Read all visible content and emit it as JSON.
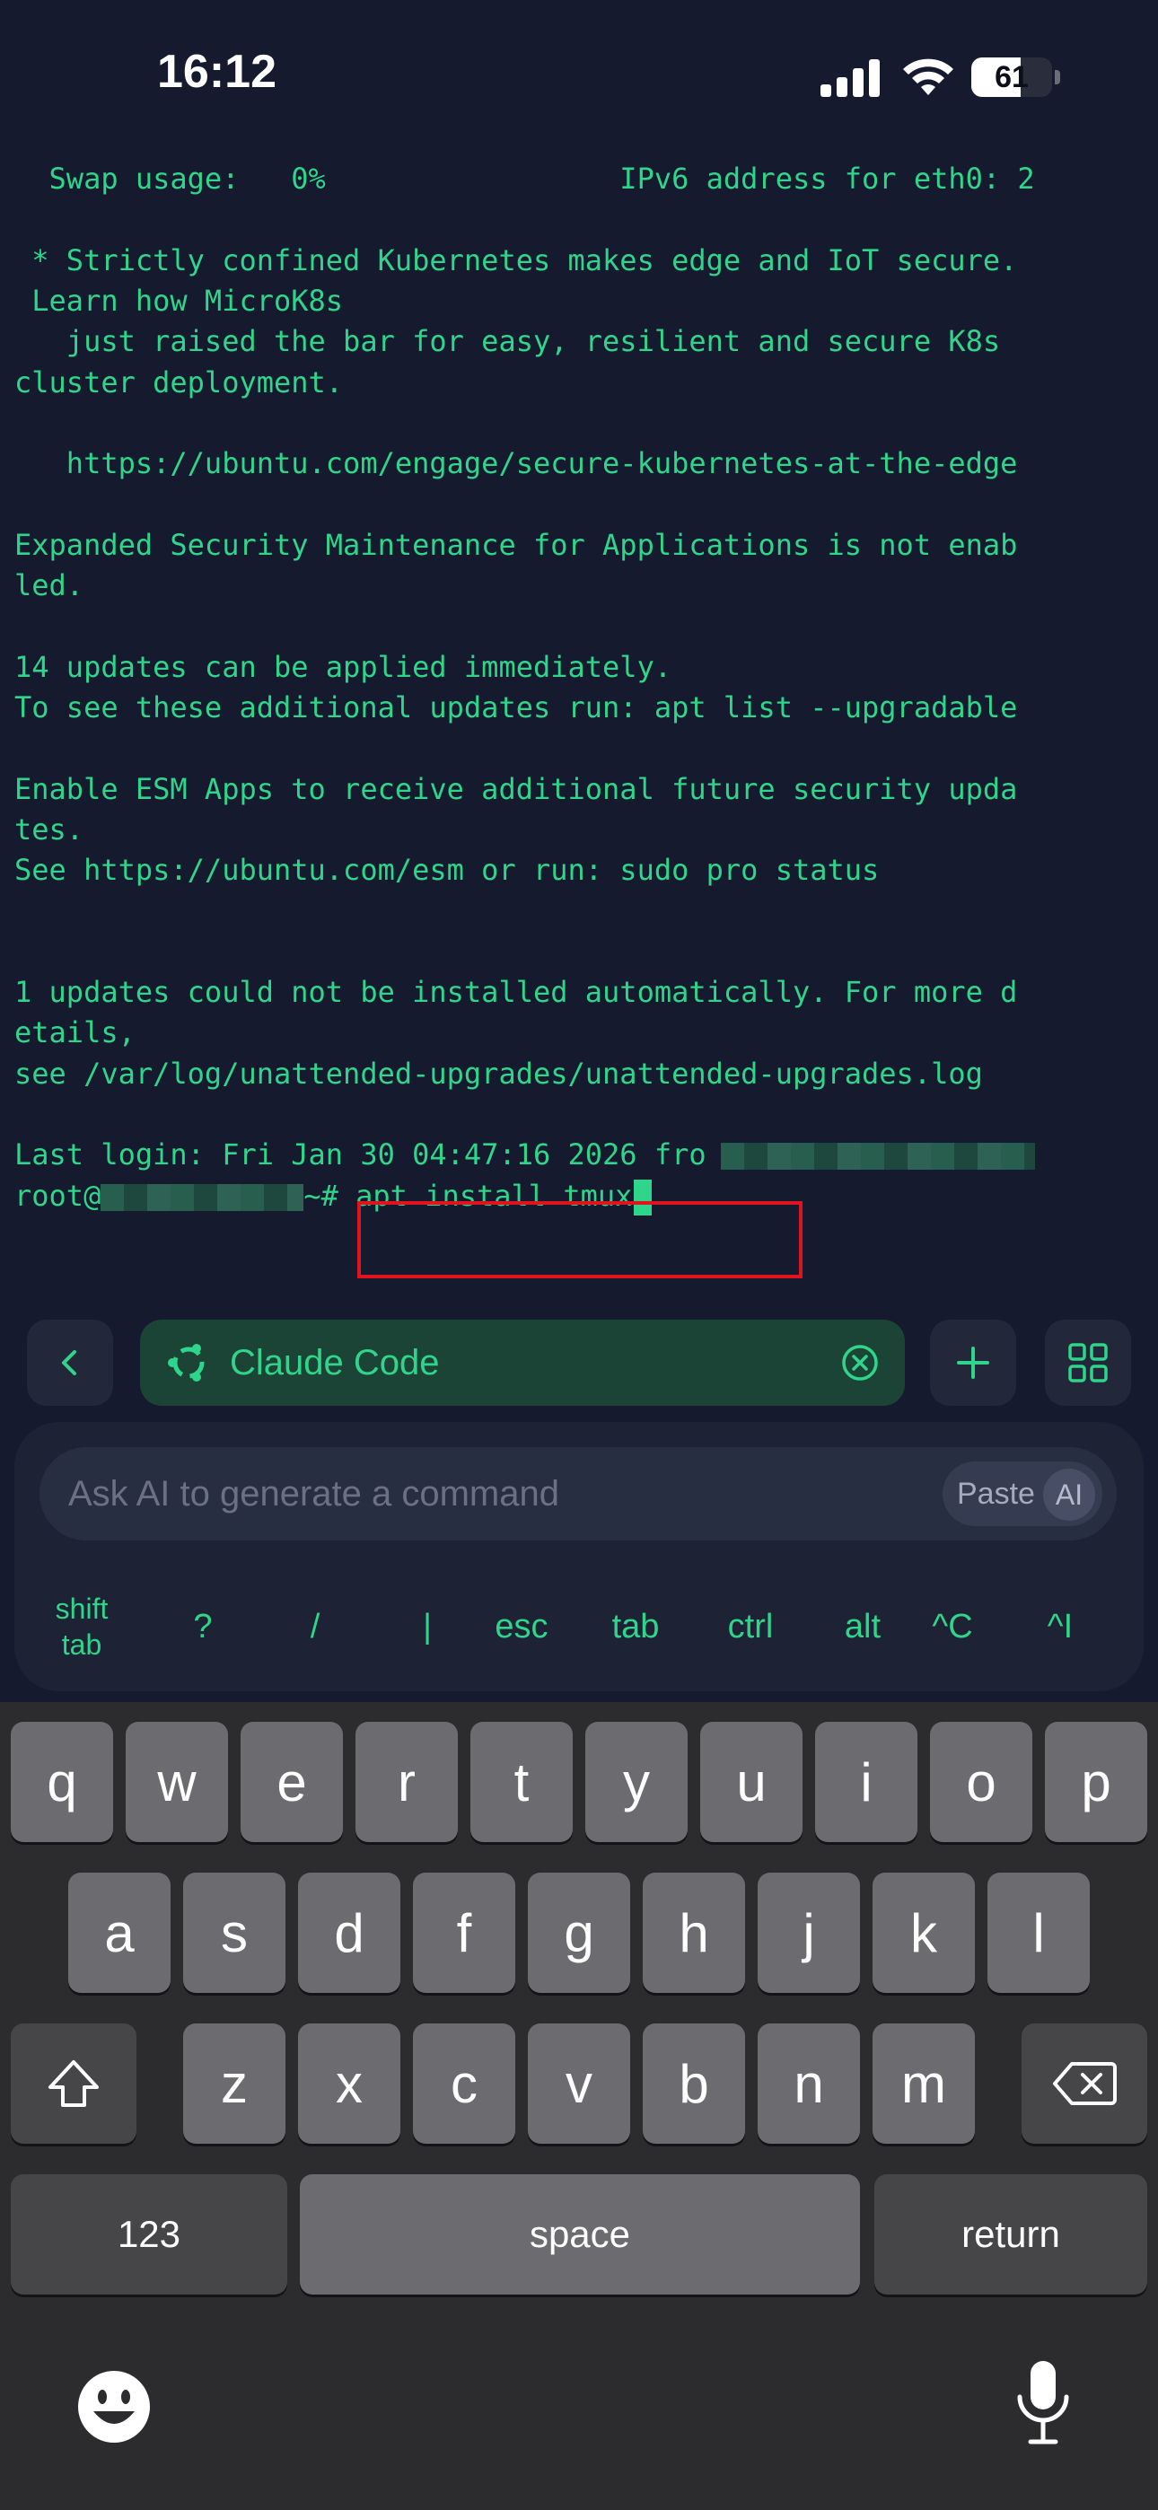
{
  "status_bar": {
    "time": "16:12",
    "battery": "61",
    "battery_level": 0.61
  },
  "terminal": {
    "lines": [
      "  Swap usage:   0%                 IPv6 address for eth0: 2",
      "",
      " * Strictly confined Kubernetes makes edge and IoT secure.",
      " Learn how MicroK8s",
      "   just raised the bar for easy, resilient and secure K8s",
      "cluster deployment.",
      "",
      "   https://ubuntu.com/engage/secure-kubernetes-at-the-edge",
      "",
      "Expanded Security Maintenance for Applications is not enab",
      "led.",
      "",
      "14 updates can be applied immediately.",
      "To see these additional updates run: apt list --upgradable",
      "",
      "Enable ESM Apps to receive additional future security upda",
      "tes.",
      "See https://ubuntu.com/esm or run: sudo pro status",
      "",
      "",
      "1 updates could not be installed automatically. For more d",
      "etails,",
      "see /var/log/unattended-upgrades/unattended-upgrades.log",
      ""
    ],
    "last_login": "Last login: Fri Jan 30 04:47:16 2026 fro",
    "prompt_user": "root@",
    "prompt_suffix": "~#",
    "command": " apt install tmux"
  },
  "session_bar": {
    "tab_label": "Claude Code"
  },
  "ai_panel": {
    "placeholder": "Ask AI to generate a command",
    "paste_label": "Paste",
    "ai_badge": "AI",
    "shift_tab_line1": "shift",
    "shift_tab_line2": "tab",
    "keys": [
      "?",
      "/",
      "|",
      "esc",
      "tab",
      "ctrl",
      "alt",
      "^C",
      "^I"
    ]
  },
  "keyboard": {
    "row1": [
      "q",
      "w",
      "e",
      "r",
      "t",
      "y",
      "u",
      "i",
      "o",
      "p"
    ],
    "row2": [
      "a",
      "s",
      "d",
      "f",
      "g",
      "h",
      "j",
      "k",
      "l"
    ],
    "row3": [
      "z",
      "x",
      "c",
      "v",
      "b",
      "n",
      "m"
    ],
    "numbers_key": "123",
    "space_key": "space",
    "return_key": "return"
  },
  "colors": {
    "background": "#151a2e",
    "terminal_text": "#2fd58a",
    "highlight_box": "#e0141e",
    "session_tab": "#1c4436"
  }
}
